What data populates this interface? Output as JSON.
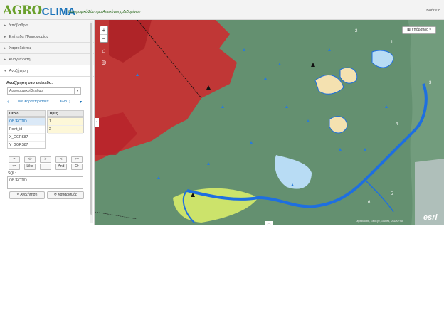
{
  "header": {
    "logo_agro": "AGRO",
    "logo_clima": "CLIMA",
    "tagline": "Γεωγραφικό Σύστημα Απεικόνισης Δεδομένων",
    "help": "Βοήθεια"
  },
  "sidebar": {
    "items": [
      {
        "label": "Υπόβαθρα"
      },
      {
        "label": "Επίπεδα Πληροφορίας"
      },
      {
        "label": "Χαρτοδείκτες"
      },
      {
        "label": "Αναγνώριση"
      },
      {
        "label": "Αναζήτηση"
      }
    ],
    "search": {
      "layer_label": "Αναζήτηση στο επίπεδο:",
      "layer_value": "Αυτογραφικοί Σταθμοί",
      "tab_characteristics": "Με Χαρακτηριστικά",
      "tab_spatial": "Χωρ",
      "fields_header": "Πεδίο",
      "values_header": "Τιμές",
      "fields": [
        "OBJECTID",
        "Point_id",
        "X_GGRS87",
        "Y_GGRS87"
      ],
      "values": [
        "1",
        "2"
      ],
      "operators": [
        "=",
        "<>",
        ">",
        "<",
        ">=",
        "<=",
        "Like",
        "",
        "And",
        "Or"
      ],
      "sql_label": "SQL:",
      "sql_value": "OBJECTID",
      "search_button": "Αναζήτηση",
      "clear_button": "Καθαρισμός"
    }
  },
  "map": {
    "basemap_button": "Υπόβαθρα",
    "attribution": "DigitalGlobe, GeoEye, i-cubed, USDA FSA",
    "esri": "esri",
    "colors": {
      "vegetation": "#5f8a6c",
      "red_zone": "#d0282c",
      "river": "#1e6fe0",
      "lake": "#b8dcf4",
      "yellow_zone": "#d7ec6a",
      "dotted_zone": "#f4e1b0"
    },
    "number_labels": [
      "1",
      "2",
      "3",
      "4",
      "5",
      "6"
    ]
  }
}
